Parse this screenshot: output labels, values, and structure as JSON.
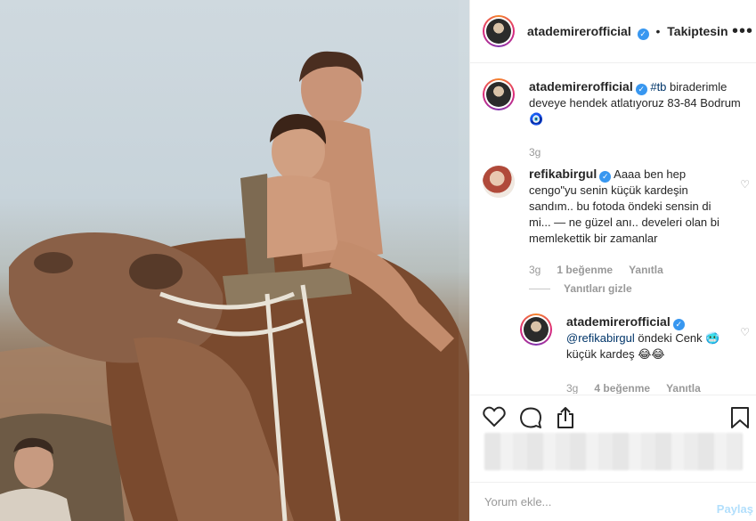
{
  "post": {
    "username": "atademirerofficial",
    "follow_status": "Takiptesin",
    "separator": "•",
    "more_label": "•••"
  },
  "caption": {
    "username": "atademirerofficial",
    "hashtag": "#tb",
    "text": " biraderimle deveye hendek atlatıyoruz 83-84 Bodrum",
    "emoji": "🧿",
    "time": "3g"
  },
  "comments": [
    {
      "username": "refikabirgul",
      "text": "Aaaa ben hep cengo\"yu senin küçük kardeşin sandım.. bu fotoda öndeki sensin di mi... — ne güzel anı.. develeri olan bi memlekettik bir zamanlar",
      "time": "3g",
      "likes": "1 beğenme",
      "reply_label": "Yanıtla"
    }
  ],
  "replies_toggle": "Yanıtları gizle",
  "reply": {
    "username": "atademirerofficial",
    "mention": "@refikabirgul",
    "text": " öndeki Cenk 🥶 küçük kardeş 😂😂",
    "time": "3g",
    "likes": "4 beğenme",
    "reply_label": "Yanıtla"
  },
  "compose": {
    "placeholder": "Yorum ekle...",
    "post_label": "Paylaş"
  },
  "icons": {
    "like": "heart-icon",
    "comment": "comment-icon",
    "share": "share-icon",
    "save": "bookmark-icon"
  },
  "colors": {
    "link": "#003569",
    "verified": "#3897f0",
    "post_button": "#b2dffc"
  }
}
